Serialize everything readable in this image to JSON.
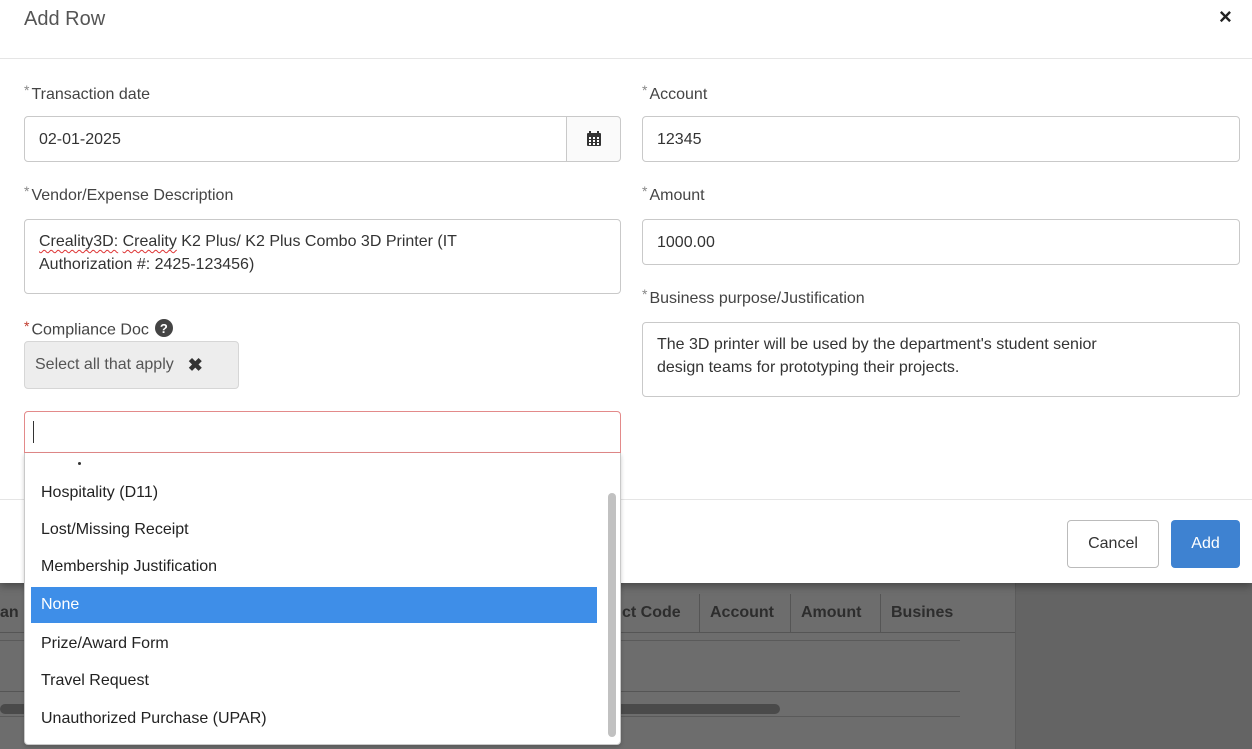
{
  "modal": {
    "title": "Add Row",
    "close_glyph": "×",
    "fields": {
      "transaction_date": {
        "label": "Transaction date",
        "required_mark": "*",
        "value": "02-01-2025"
      },
      "account": {
        "label": "Account",
        "required_mark": "*",
        "value": "12345"
      },
      "vendor": {
        "label": "Vendor/Expense Description",
        "required_mark": "*",
        "line1_misspelled_a": "Creality3D:",
        "line1_mid": " ",
        "line1_misspelled_b": "Creality",
        "line1_rest": " K2 Plus/ K2 Plus Combo 3D Printer (IT",
        "line2": "Authorization #: 2425-123456)"
      },
      "amount": {
        "label": "Amount",
        "required_mark": "*",
        "value": "1000.00"
      },
      "business_purpose": {
        "label": "Business purpose/Justification",
        "required_mark": "*",
        "line1": "The 3D printer will be used by the department's student senior",
        "line2": "design teams for prototyping their projects."
      },
      "compliance_doc": {
        "label": "Compliance Doc",
        "required_mark": "*",
        "help_glyph": "?",
        "placeholder_tag": "Select all that apply",
        "clear_glyph": "✖",
        "search_value": ""
      }
    },
    "dropdown_options": [
      {
        "label": "Hospitality (D11)",
        "selected": false
      },
      {
        "label": "Lost/Missing Receipt",
        "selected": false
      },
      {
        "label": "Membership Justification",
        "selected": false
      },
      {
        "label": "None",
        "selected": true
      },
      {
        "label": "Prize/Award Form",
        "selected": false
      },
      {
        "label": "Travel Request",
        "selected": false
      },
      {
        "label": "Unauthorized Purchase (UPAR)",
        "selected": false
      }
    ],
    "buttons": {
      "cancel": "Cancel",
      "add": "Add"
    }
  },
  "background_table": {
    "headers": [
      {
        "label": "an"
      },
      {
        "label": "ct Code"
      },
      {
        "label": "Account"
      },
      {
        "label": "Amount"
      },
      {
        "label": "Busines"
      }
    ]
  },
  "colors": {
    "primary": "#3e82d1",
    "selected_option": "#3e8ee8",
    "required_red": "#c0392b",
    "overlay": "#6d6d6d"
  },
  "icons": {
    "calendar": "calendar-icon",
    "close": "close-icon",
    "help": "question-circle-icon",
    "clear": "clear-x-icon"
  }
}
